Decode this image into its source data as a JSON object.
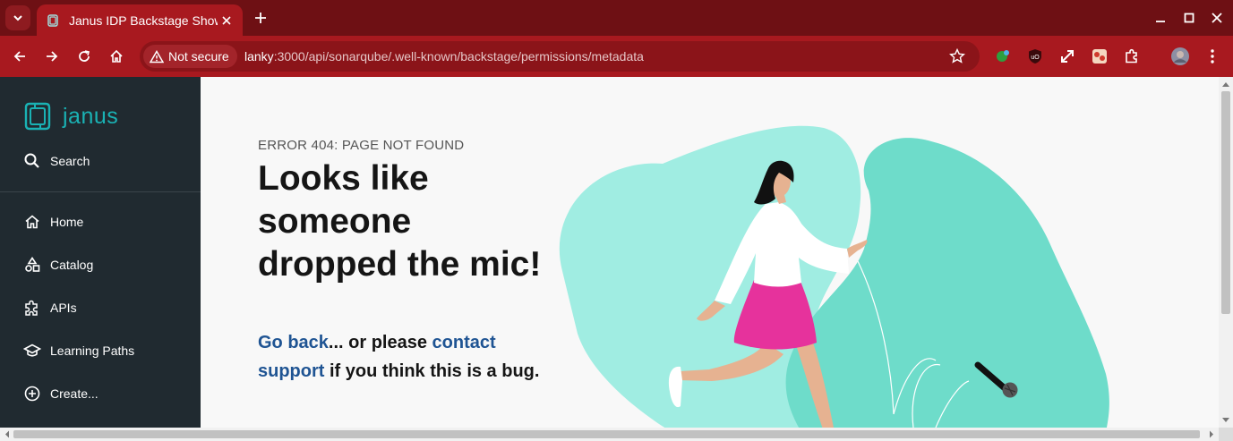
{
  "browser": {
    "tab_title": "Janus IDP Backstage Showcase",
    "security_chip": "Not secure",
    "url_host": "lanky",
    "url_path": ":3000/api/sonarqube/.well-known/backstage/permissions/metadata"
  },
  "sidebar": {
    "logo_text": "janus",
    "search_label": "Search",
    "items": [
      {
        "label": "Home",
        "icon": "home-icon"
      },
      {
        "label": "Catalog",
        "icon": "catalog-icon"
      },
      {
        "label": "APIs",
        "icon": "puzzle-icon"
      },
      {
        "label": "Learning Paths",
        "icon": "school-icon"
      },
      {
        "label": "Create...",
        "icon": "add-circle-icon"
      }
    ]
  },
  "error": {
    "code": "ERROR 404: PAGE NOT FOUND",
    "headline_lines": [
      "Looks like",
      "someone",
      "dropped the mic!"
    ],
    "go_back": "Go back",
    "middle_text": "... or please ",
    "contact_line1": "contact",
    "contact_line2": "support",
    "tail_text": " if you think this is a bug."
  },
  "colors": {
    "titlebar": "#6e1014",
    "toolbar": "#a8191f",
    "sidebar": "#202a30",
    "accent": "#1ab2b4",
    "link": "#1f5493"
  }
}
